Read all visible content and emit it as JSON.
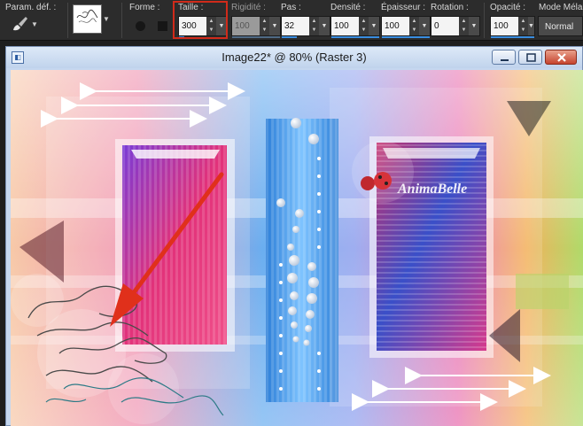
{
  "toolbar": {
    "preset_label": "Param. déf. :",
    "shape_label": "Forme :",
    "fields": [
      {
        "label": "Taille :",
        "value": "300",
        "highlighted": true
      },
      {
        "label": "Rigidité :",
        "value": "100",
        "disabled": true
      },
      {
        "label": "Pas :",
        "value": "32"
      },
      {
        "label": "Densité :",
        "value": "100"
      },
      {
        "label": "Épaisseur :",
        "value": "100"
      },
      {
        "label": "Rotation :",
        "value": "0"
      },
      {
        "label": "Opacité :",
        "value": "100"
      }
    ],
    "blend_mode": {
      "label": "Mode Mélan",
      "value": "Normal"
    },
    "highlight_color": "#d02a1a",
    "accent_color": "#3a8de0"
  },
  "window": {
    "title": "Image22* @  80% (Raster 3)",
    "controls": [
      "minimize-icon",
      "maximize-icon",
      "close-icon"
    ]
  },
  "canvas": {
    "watermark": "AnimaBelle",
    "arrow_color": "#e0301b"
  }
}
